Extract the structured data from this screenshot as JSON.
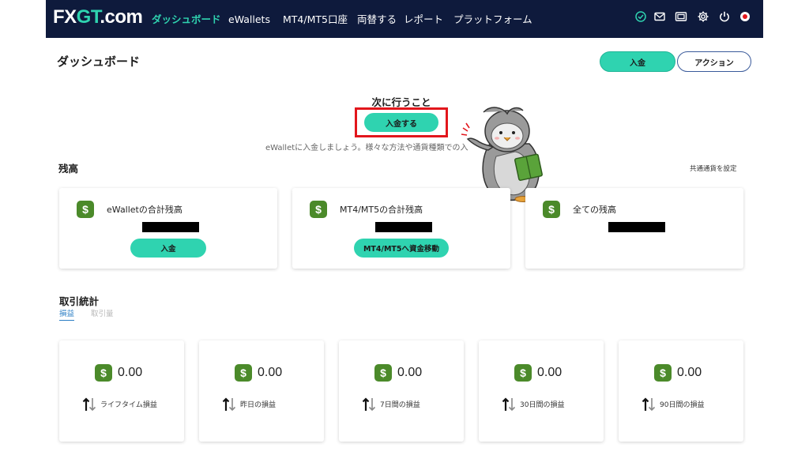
{
  "nav": {
    "logo_fx": "FX",
    "logo_gt": "GT",
    "logo_com": ".com",
    "items": [
      {
        "label": "ダッシュボード",
        "active": true
      },
      {
        "label": "eWallets",
        "active": false
      },
      {
        "label": "MT4/MT5口座",
        "active": false
      },
      {
        "label": "両替する",
        "active": false
      },
      {
        "label": "レポート",
        "active": false
      },
      {
        "label": "プラットフォーム",
        "active": false
      }
    ],
    "icons": [
      "verified-check-icon",
      "mail-icon",
      "wallet-icon",
      "gear-icon",
      "power-icon",
      "record-icon"
    ]
  },
  "header": {
    "title": "ダッシュボード",
    "deposit_label": "入金",
    "action_label": "アクション"
  },
  "next_steps": {
    "title": "次に行うこと",
    "button_label": "入金する",
    "description": "eWalletに入金しましょう。様々な方法や通貨種類での入"
  },
  "balance": {
    "section_title": "残高",
    "set_currency_label": "共通通貨を設定",
    "cards": [
      {
        "label": "eWalletの合計残高",
        "button_label": "入金"
      },
      {
        "label": "MT4/MT5の合計残高",
        "button_label": "MT4/MT5へ資金移動"
      },
      {
        "label": "全ての残高",
        "button_label": ""
      }
    ]
  },
  "stats": {
    "section_title": "取引統計",
    "tabs": [
      {
        "label": "損益",
        "active": true
      },
      {
        "label": "取引量",
        "active": false
      }
    ],
    "cards": [
      {
        "value": "0.00",
        "label": "ライフタイム損益"
      },
      {
        "value": "0.00",
        "label": "昨日の損益"
      },
      {
        "value": "0.00",
        "label": "7日間の損益"
      },
      {
        "value": "0.00",
        "label": "30日間の損益"
      },
      {
        "value": "0.00",
        "label": "90日間の損益"
      }
    ]
  },
  "colors": {
    "nav_bg": "#0e1a3c",
    "accent": "#2fd3b0",
    "dollar_badge": "#4b8a2a",
    "highlight": "#e2161c"
  }
}
